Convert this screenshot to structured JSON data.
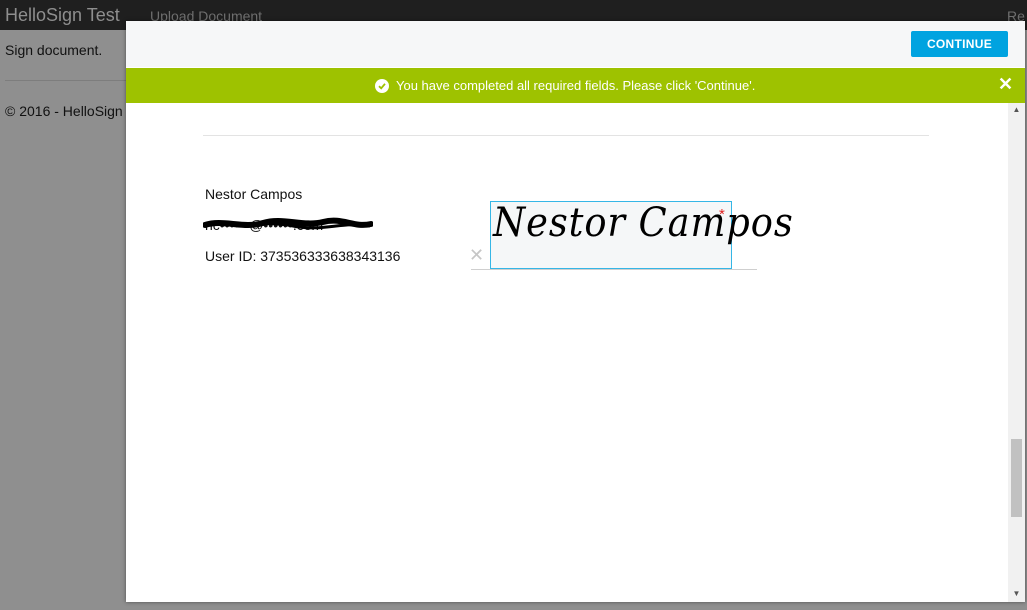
{
  "page": {
    "brand": "HelloSign Test",
    "nav_upload": "Upload Document",
    "nav_right_partial": "Re",
    "body_text": "Sign document.",
    "footer": "© 2016 - HelloSign"
  },
  "modal": {
    "continue_label": "CONTINUE",
    "banner_message": "You have completed all required fields. Please click 'Continue'.",
    "close_glyph": "✕",
    "signer": {
      "name": "Nestor Campos",
      "email": "nc••••••@••••••.com",
      "user_id": "User ID: 373536333638343136"
    },
    "signature": {
      "text": "Nestor Campos",
      "required_mark": "*",
      "delete_glyph": "✕"
    }
  },
  "colors": {
    "accent": "#00a3e0",
    "banner": "#9ec200",
    "signature_border": "#35b6e6",
    "required": "#e02020"
  },
  "icons": {
    "banner_status": "check-circle-icon",
    "banner_close": "close-icon",
    "signature_delete": "close-icon"
  }
}
